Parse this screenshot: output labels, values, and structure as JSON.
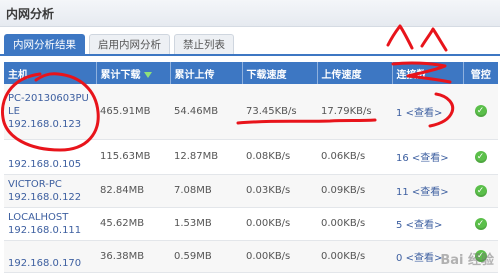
{
  "window": {
    "title": "内网分析"
  },
  "tabs": [
    {
      "label": "内网分析结果"
    },
    {
      "label": "启用内网分析"
    },
    {
      "label": "禁止列表"
    }
  ],
  "table": {
    "headers": {
      "host": "主机",
      "total_down": "累计下载",
      "total_up": "累计上传",
      "down_speed": "下载速度",
      "up_speed": "上传速度",
      "conn": "连接数",
      "ctrl": "管控"
    },
    "rows": [
      {
        "name": "PC-20130603PU\nLE",
        "ip": "192.168.0.123",
        "down": "465.91MB",
        "up": "54.46MB",
        "dspeed": "73.45KB/s",
        "uspeed": "17.79KB/s",
        "conn": "1",
        "view": "<查看>"
      },
      {
        "name": "",
        "ip": "192.168.0.105",
        "down": "115.63MB",
        "up": "12.87MB",
        "dspeed": "0.08KB/s",
        "uspeed": "0.06KB/s",
        "conn": "16",
        "view": "<查看>"
      },
      {
        "name": "VICTOR-PC",
        "ip": "192.168.0.122",
        "down": "82.84MB",
        "up": "7.08MB",
        "dspeed": "0.03KB/s",
        "uspeed": "0.09KB/s",
        "conn": "11",
        "view": "<查看>"
      },
      {
        "name": "LOCALHOST",
        "ip": "192.168.0.111",
        "down": "45.62MB",
        "up": "1.53MB",
        "dspeed": "0.00KB/s",
        "uspeed": "0.00KB/s",
        "conn": "5",
        "view": "<查看>"
      },
      {
        "name": "",
        "ip": "192.168.0.170",
        "down": "36.38MB",
        "up": "0.59MB",
        "dspeed": "0.00KB/s",
        "uspeed": "0.00KB/s",
        "conn": "0",
        "view": "<查看>"
      }
    ]
  },
  "icons": {
    "sort": "sort-down-icon",
    "control": "check-circle-icon"
  },
  "colors": {
    "accent": "#3d77c3",
    "annotation": "#e8141b",
    "check": "#5bbf4a"
  },
  "watermark": "Bai 经验"
}
